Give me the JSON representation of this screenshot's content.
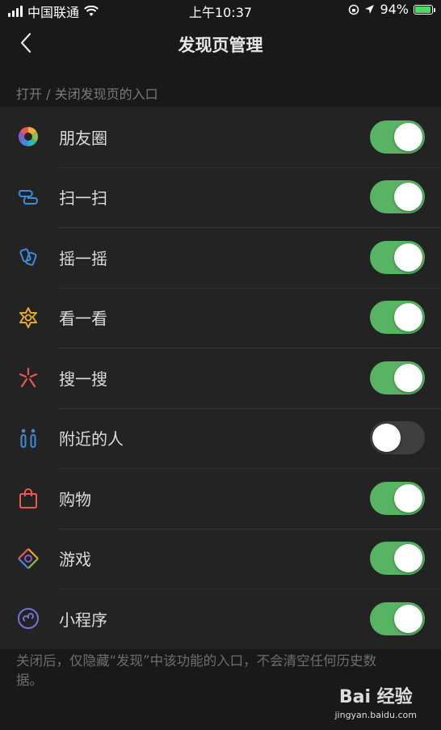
{
  "status_bar": {
    "carrier": "中国联通",
    "time": "上午10:37",
    "battery": "94%",
    "battery_level": 0.94
  },
  "nav": {
    "title": "发现页管理"
  },
  "section_header": "打开 / 关闭发现页的入口",
  "items": [
    {
      "label": "朋友圈",
      "icon": "moments-icon",
      "on": true
    },
    {
      "label": "扫一扫",
      "icon": "scan-icon",
      "on": true
    },
    {
      "label": "摇一摇",
      "icon": "shake-icon",
      "on": true
    },
    {
      "label": "看一看",
      "icon": "top-stories-icon",
      "on": true
    },
    {
      "label": "搜一搜",
      "icon": "search-icon",
      "on": true
    },
    {
      "label": "附近的人",
      "icon": "people-nearby-icon",
      "on": false
    },
    {
      "label": "购物",
      "icon": "shopping-bag-icon",
      "on": true
    },
    {
      "label": "游戏",
      "icon": "games-icon",
      "on": true
    },
    {
      "label": "小程序",
      "icon": "mini-programs-icon",
      "on": true
    }
  ],
  "footer_note": "关闭后，仅隐藏“发现”中该功能的入口，不会清空任何历史数据。",
  "watermark": {
    "logo_text": "Bai 经验",
    "url": "jingyan.baidu.com"
  },
  "colors": {
    "toggle_on": "#57b462",
    "toggle_off": "#3f3f3f",
    "background": "#191919",
    "list_background": "#232323"
  }
}
